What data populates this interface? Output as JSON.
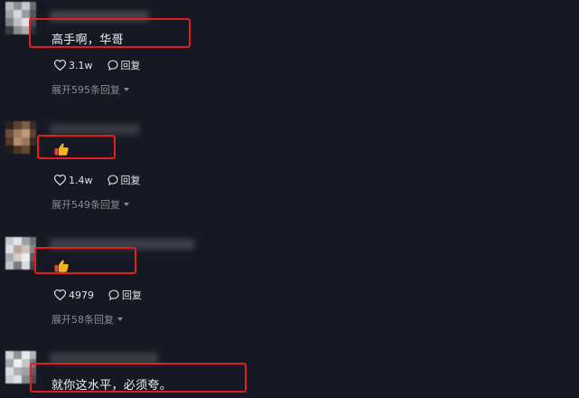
{
  "comments": [
    {
      "text": "高手啊，华哥",
      "likes": "3.1w",
      "reply_label": "回复",
      "expand_label": "展开595条回复"
    },
    {
      "emoji": "thumbs-up",
      "likes": "1.4w",
      "reply_label": "回复",
      "expand_label": "展开549条回复"
    },
    {
      "emoji": "thumbs-up",
      "likes": "4979",
      "reply_label": "回复",
      "expand_label": "展开58条回复"
    },
    {
      "text": "就你这水平，必须夸。"
    }
  ],
  "colors": {
    "background": "#161823",
    "highlight_box": "#e0201f",
    "muted_text": "#8a8b91"
  }
}
